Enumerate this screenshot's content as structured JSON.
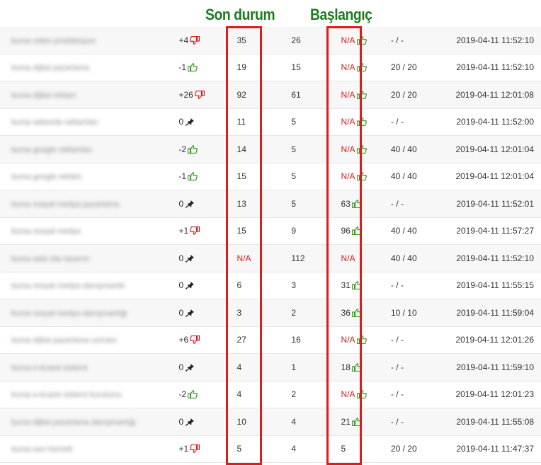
{
  "headlines": {
    "son_durum": "Son durum",
    "baslangic": "Başlangıç"
  },
  "colors": {
    "accent_green": "#1f7a1f",
    "frame_red": "#e01b1b",
    "na_red": "#d42020",
    "thumb_green": "#3a9a2a",
    "thumb_red": "#d42020"
  },
  "rows": [
    {
      "keyword": "bursa video prodüksiyon",
      "change": "+4",
      "change_icon": "thumb-down-icon",
      "current": "35",
      "previous": "26",
      "start": "N/A",
      "start_icon": "thumb-up-icon",
      "volume": "- / -",
      "date": "2019-04-11 11:52:10"
    },
    {
      "keyword": "bursa dijital pazarlama",
      "change": "-1",
      "change_icon": "thumb-up-icon",
      "current": "19",
      "previous": "15",
      "start": "N/A",
      "start_icon": "thumb-up-icon",
      "volume": "20 / 20",
      "date": "2019-04-11 11:52:10"
    },
    {
      "keyword": "bursa dijital reklam",
      "change": "+26",
      "change_icon": "thumb-down-icon",
      "current": "92",
      "previous": "61",
      "start": "N/A",
      "start_icon": "thumb-up-icon",
      "volume": "20 / 20",
      "date": "2019-04-11 12:01:08"
    },
    {
      "keyword": "bursa adwords reklamları",
      "change": "0",
      "change_icon": "pin-icon",
      "current": "11",
      "previous": "5",
      "start": "N/A",
      "start_icon": "thumb-up-icon",
      "volume": "- / -",
      "date": "2019-04-11 11:52:00"
    },
    {
      "keyword": "bursa google reklamları",
      "change": "-2",
      "change_icon": "thumb-up-icon",
      "current": "14",
      "previous": "5",
      "start": "N/A",
      "start_icon": "thumb-up-icon",
      "volume": "40 / 40",
      "date": "2019-04-11 12:01:04"
    },
    {
      "keyword": "bursa google reklam",
      "change": "-1",
      "change_icon": "thumb-up-icon",
      "current": "15",
      "previous": "5",
      "start": "N/A",
      "start_icon": "thumb-up-icon",
      "volume": "40 / 40",
      "date": "2019-04-11 12:01:04"
    },
    {
      "keyword": "bursa sosyal medya pazarlama",
      "change": "0",
      "change_icon": "pin-icon",
      "current": "13",
      "previous": "5",
      "start": "63",
      "start_icon": "thumb-up-icon",
      "volume": "- / -",
      "date": "2019-04-11 11:52:01"
    },
    {
      "keyword": "bursa sosyal medya",
      "change": "+1",
      "change_icon": "thumb-down-icon",
      "current": "15",
      "previous": "9",
      "start": "96",
      "start_icon": "thumb-up-icon",
      "volume": "40 / 40",
      "date": "2019-04-11 11:57:27"
    },
    {
      "keyword": "bursa web site tasarım",
      "change": "0",
      "change_icon": "pin-icon",
      "current": "N/A",
      "previous": "112",
      "start": "N/A",
      "start_icon": "",
      "volume": "40 / 40",
      "date": "2019-04-11 11:52:10"
    },
    {
      "keyword": "bursa sosyal medya danışmanlık",
      "change": "0",
      "change_icon": "pin-icon",
      "current": "6",
      "previous": "3",
      "start": "31",
      "start_icon": "thumb-up-icon",
      "volume": "- / -",
      "date": "2019-04-11 11:55:15"
    },
    {
      "keyword": "bursa sosyal medya danışmanlığı",
      "change": "0",
      "change_icon": "pin-icon",
      "current": "3",
      "previous": "2",
      "start": "36",
      "start_icon": "thumb-up-icon",
      "volume": "10 / 10",
      "date": "2019-04-11 11:59:04"
    },
    {
      "keyword": "bursa dijital pazarlama uzmanı",
      "change": "+6",
      "change_icon": "thumb-down-icon",
      "current": "27",
      "previous": "16",
      "start": "N/A",
      "start_icon": "thumb-up-icon",
      "volume": "- / -",
      "date": "2019-04-11 12:01:26"
    },
    {
      "keyword": "bursa e-ticaret sistemi",
      "change": "0",
      "change_icon": "pin-icon",
      "current": "4",
      "previous": "1",
      "start": "18",
      "start_icon": "thumb-up-icon",
      "volume": "- / -",
      "date": "2019-04-11 11:59:10"
    },
    {
      "keyword": "bursa e-ticaret sistemi kurulumu",
      "change": "-2",
      "change_icon": "thumb-up-icon",
      "current": "4",
      "previous": "2",
      "start": "N/A",
      "start_icon": "thumb-up-icon",
      "volume": "- / -",
      "date": "2019-04-11 12:01:23"
    },
    {
      "keyword": "bursa dijital pazarlama danışmanlığı",
      "change": "0",
      "change_icon": "pin-icon",
      "current": "10",
      "previous": "4",
      "start": "21",
      "start_icon": "thumb-up-icon",
      "volume": "- / -",
      "date": "2019-04-11 11:55:08"
    },
    {
      "keyword": "bursa seo hizmeti",
      "change": "+1",
      "change_icon": "thumb-down-icon",
      "current": "5",
      "previous": "4",
      "start": "5",
      "start_icon": "",
      "volume": "20 / 20",
      "date": "2019-04-11 11:47:37"
    }
  ]
}
